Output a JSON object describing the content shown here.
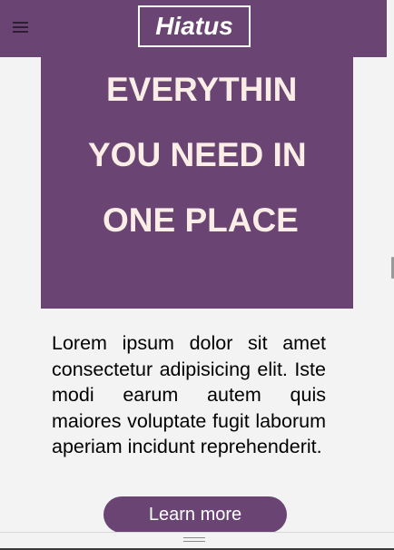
{
  "header": {
    "brand": "Hiatus",
    "menu_icon": "hamburger-menu-icon"
  },
  "hero": {
    "title_lines": [
      "EVERYTHIN",
      "YOU NEED IN",
      "ONE PLACE"
    ]
  },
  "content": {
    "paragraph": "Lorem ipsum dolor sit amet consectetur adipisicing elit. Iste modi earum autem quis maiores voluptate fugit laborum aperiam incidunt reprehenderit.",
    "cta_label": "Learn more"
  },
  "colors": {
    "brand": "#6a4573",
    "hero_text": "#fbeee6",
    "background": "#f4f3f4"
  }
}
